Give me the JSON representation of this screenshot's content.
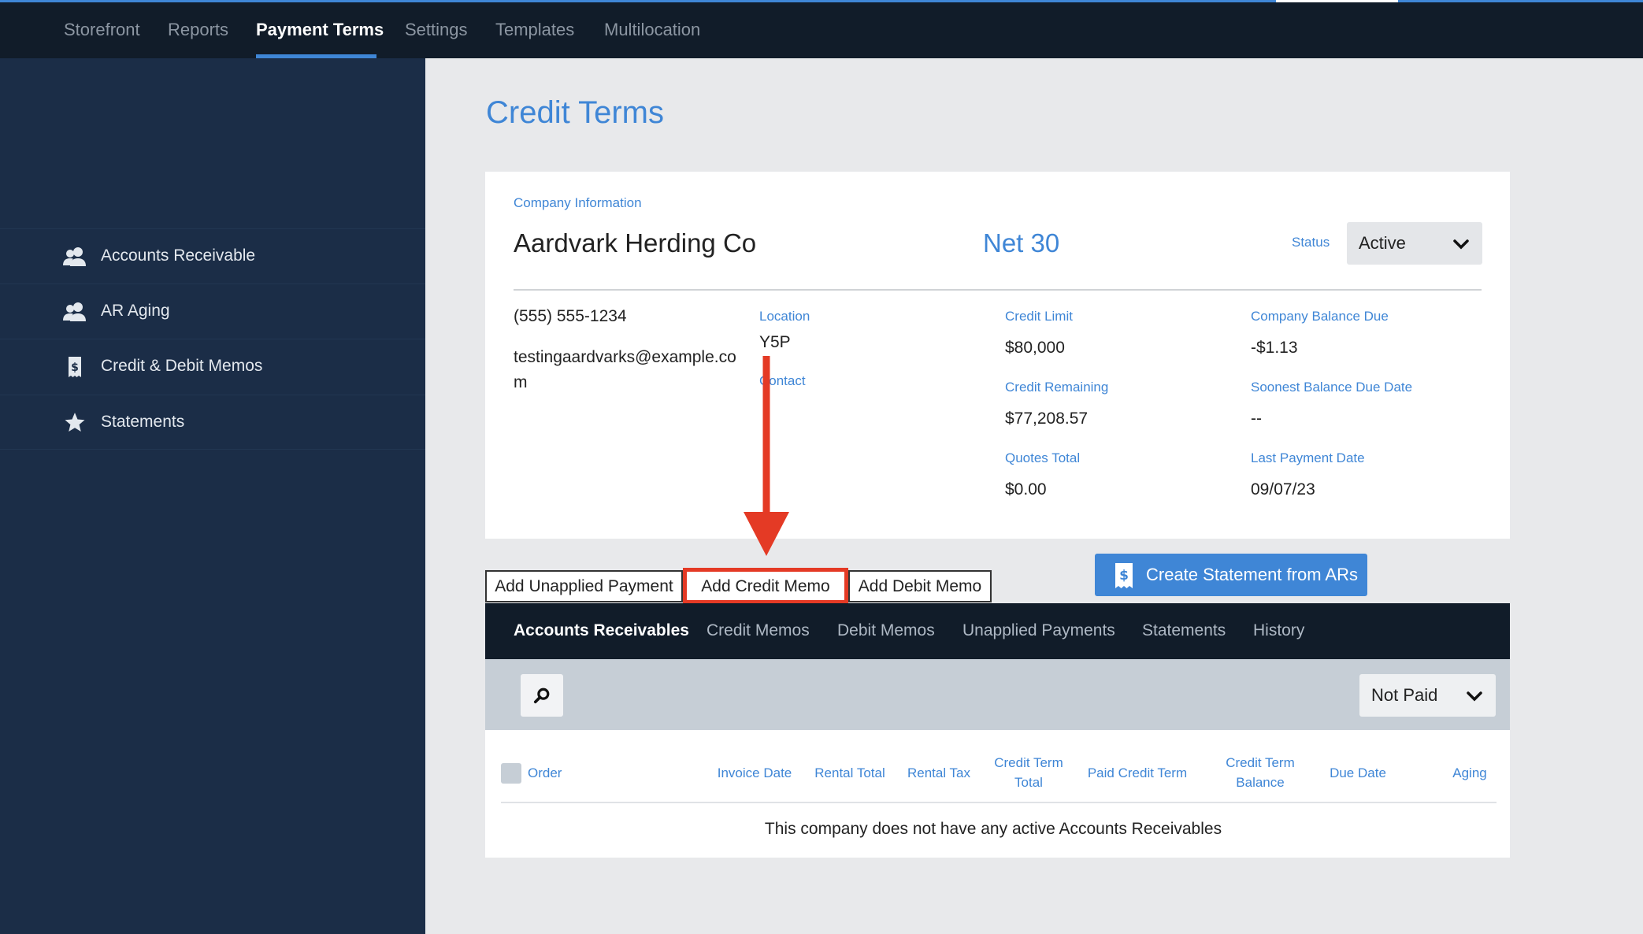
{
  "topnav": {
    "items": [
      "Storefront",
      "Reports",
      "Payment Terms",
      "Settings",
      "Templates",
      "Multilocation"
    ],
    "active": "Payment Terms"
  },
  "sidebar": {
    "items": [
      {
        "label": "Accounts Receivable",
        "icon": "users-icon"
      },
      {
        "label": "AR Aging",
        "icon": "users-icon"
      },
      {
        "label": "Credit & Debit Memos",
        "icon": "receipt-icon"
      },
      {
        "label": "Statements",
        "icon": "star-icon"
      }
    ]
  },
  "page": {
    "title": "Credit Terms"
  },
  "company": {
    "section_label": "Company Information",
    "name": "Aardvark Herding Co",
    "terms": "Net 30",
    "status_label": "Status",
    "status_value": "Active",
    "phone": "(555) 555-1234",
    "email_line1": "testingaardvarks@example.co",
    "email_line2": "m",
    "location_label": "Location",
    "location_value": "Y5P",
    "contact_label": "Contact",
    "credit_limit_label": "Credit Limit",
    "credit_limit": "$80,000",
    "credit_remaining_label": "Credit Remaining",
    "credit_remaining": "$77,208.57",
    "quotes_total_label": "Quotes Total",
    "quotes_total": "$0.00",
    "balance_due_label": "Company Balance Due",
    "balance_due": "-$1.13",
    "soonest_due_label": "Soonest Balance Due Date",
    "soonest_due": "--",
    "last_payment_label": "Last Payment Date",
    "last_payment": "09/07/23"
  },
  "actions": {
    "add_unapplied_payment": "Add Unapplied Payment",
    "add_credit_memo": "Add Credit Memo",
    "add_debit_memo": "Add Debit Memo",
    "create_statement": "Create Statement from ARs"
  },
  "tabs": [
    "Accounts Receivables",
    "Credit Memos",
    "Debit Memos",
    "Unapplied Payments",
    "Statements",
    "History"
  ],
  "filter": {
    "status_value": "Not Paid"
  },
  "table": {
    "columns": [
      "Order",
      "Invoice Date",
      "Rental Total",
      "Rental Tax",
      "Credit Term Total",
      "Paid Credit Term",
      "Credit Term Balance",
      "Due Date",
      "Aging"
    ],
    "empty_message": "This company does not have any active Accounts Receivables"
  },
  "colors": {
    "accent": "#3f86d6",
    "nav_bg": "#111c29",
    "sidebar_bg": "#1b2d47",
    "annotation": "#e43a25"
  }
}
